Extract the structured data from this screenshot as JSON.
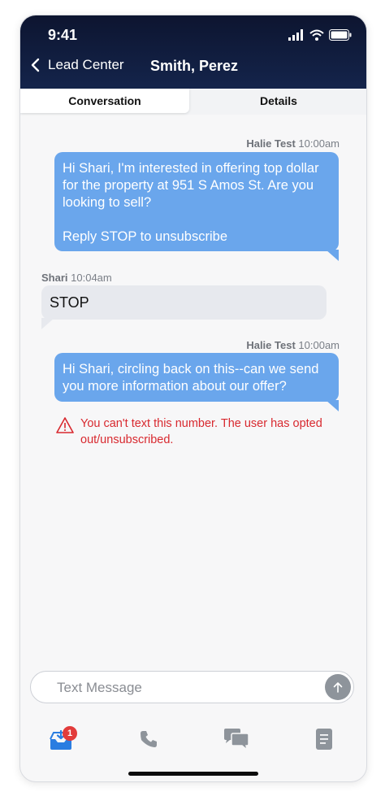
{
  "status_bar": {
    "time": "9:41"
  },
  "header": {
    "back_label": "Lead Center",
    "title": "Smith, Perez"
  },
  "tabs": [
    {
      "label": "Conversation",
      "active": true
    },
    {
      "label": "Details",
      "active": false
    }
  ],
  "messages": [
    {
      "direction": "outgoing",
      "sender": "Halie Test",
      "time": "10:00am",
      "lines": [
        "Hi Shari, I'm interested in offering top dollar",
        "for the property at 951 S Amos St. Are you",
        "looking to sell?",
        "",
        "Reply STOP to unsubscribe"
      ]
    },
    {
      "direction": "incoming",
      "sender": "Shari",
      "time": "10:04am",
      "text": "STOP"
    },
    {
      "direction": "outgoing",
      "sender": "Halie Test",
      "time": "10:00am",
      "lines": [
        "Hi Shari, circling back on this--can we send",
        "you more information about our offer?"
      ]
    }
  ],
  "error": {
    "lines": [
      "You can't text this number. The user has opted",
      "out/unsubscribed."
    ]
  },
  "composer": {
    "placeholder": "Text Message",
    "value": ""
  },
  "bottom_nav": [
    {
      "icon": "inbox-icon",
      "badge": "1",
      "active": true
    },
    {
      "icon": "phone-icon"
    },
    {
      "icon": "chat-icon"
    },
    {
      "icon": "document-icon"
    }
  ],
  "colors": {
    "header_bg": "#14244b",
    "outgoing_bubble": "#6aa6ec",
    "incoming_bubble": "#e7e9ee",
    "error": "#d8292f",
    "active_nav": "#2a7de1",
    "inactive_nav": "#8e949b",
    "badge": "#e23b3b"
  }
}
